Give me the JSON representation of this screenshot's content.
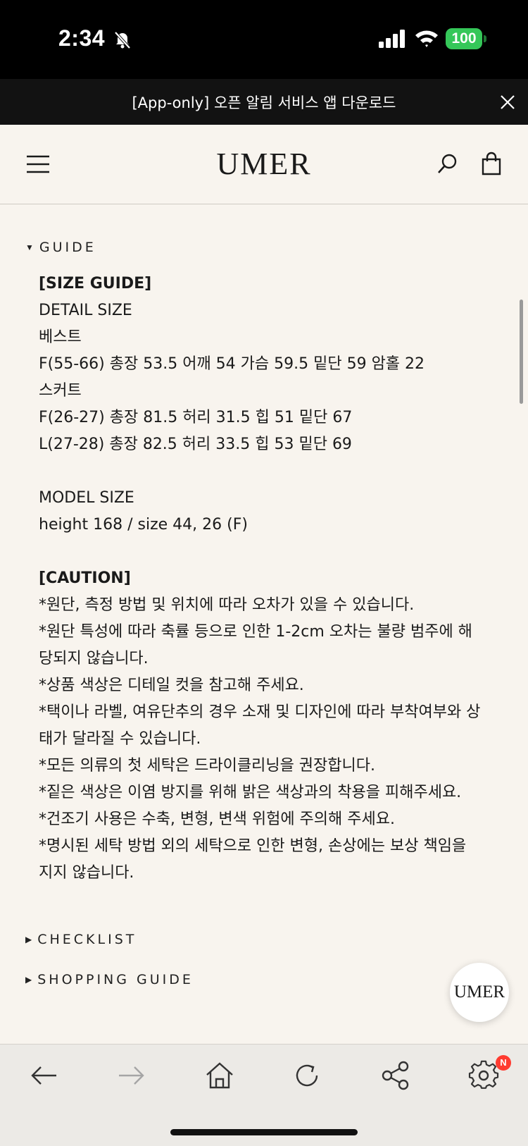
{
  "status_bar": {
    "time": "2:34",
    "battery": "100"
  },
  "banner": {
    "text": "[App-only] 오픈 알림 서비스 앱 다운로드"
  },
  "header": {
    "logo": "UMER"
  },
  "guide": {
    "toggle_label": "GUIDE",
    "size_heading": "[SIZE GUIDE]",
    "detail_size": "DETAIL SIZE",
    "vest_label": "베스트",
    "vest_f": "F(55-66) 총장 53.5 어깨 54 가슴 59.5 밑단 59 암홀 22",
    "skirt_label": "스커트",
    "skirt_f": "F(26-27) 총장 81.5 허리 31.5 힙 51 밑단 67",
    "skirt_l": "L(27-28) 총장 82.5 허리 33.5 힙 53 밑단 69",
    "model_size": "MODEL SIZE",
    "model_detail": "height 168 / size 44, 26 (F)",
    "caution_heading": "[CAUTION]",
    "caution_lines": [
      "*원단, 측정 방법 및 위치에 따라 오차가 있을 수 있습니다.",
      "*원단 특성에 따라 축률 등으로 인한 1-2cm 오차는 불량 범주에 해",
      "당되지 않습니다.",
      "*상품 색상은 디테일 컷을 참고해 주세요.",
      "*택이나 라벨, 여유단추의 경우 소재 및 디자인에 따라 부착여부와 상",
      "태가 달라질 수 있습니다.",
      "*모든 의류의 첫 세탁은 드라이클리닝을 권장합니다.",
      "*짙은 색상은 이염 방지를 위해 밝은 색상과의 착용을 피해주세요.",
      "*건조기 사용은 수축, 변형, 변색 위험에 주의해 주세요.",
      "*명시된 세탁 방법 외의 세탁으로 인한 변형, 손상에는 보상 책임을",
      "지지 않습니다."
    ]
  },
  "checklist": {
    "toggle_label": "CHECKLIST"
  },
  "shopping_guide": {
    "toggle_label": "SHOPPING GUIDE"
  },
  "float_button": {
    "label": "UMER"
  },
  "bottom_nav": {
    "settings_badge": "N"
  },
  "colors": {
    "background": "#f8f4ee",
    "banner": "#121212",
    "battery": "#35c759",
    "badge": "#ff3b30"
  }
}
